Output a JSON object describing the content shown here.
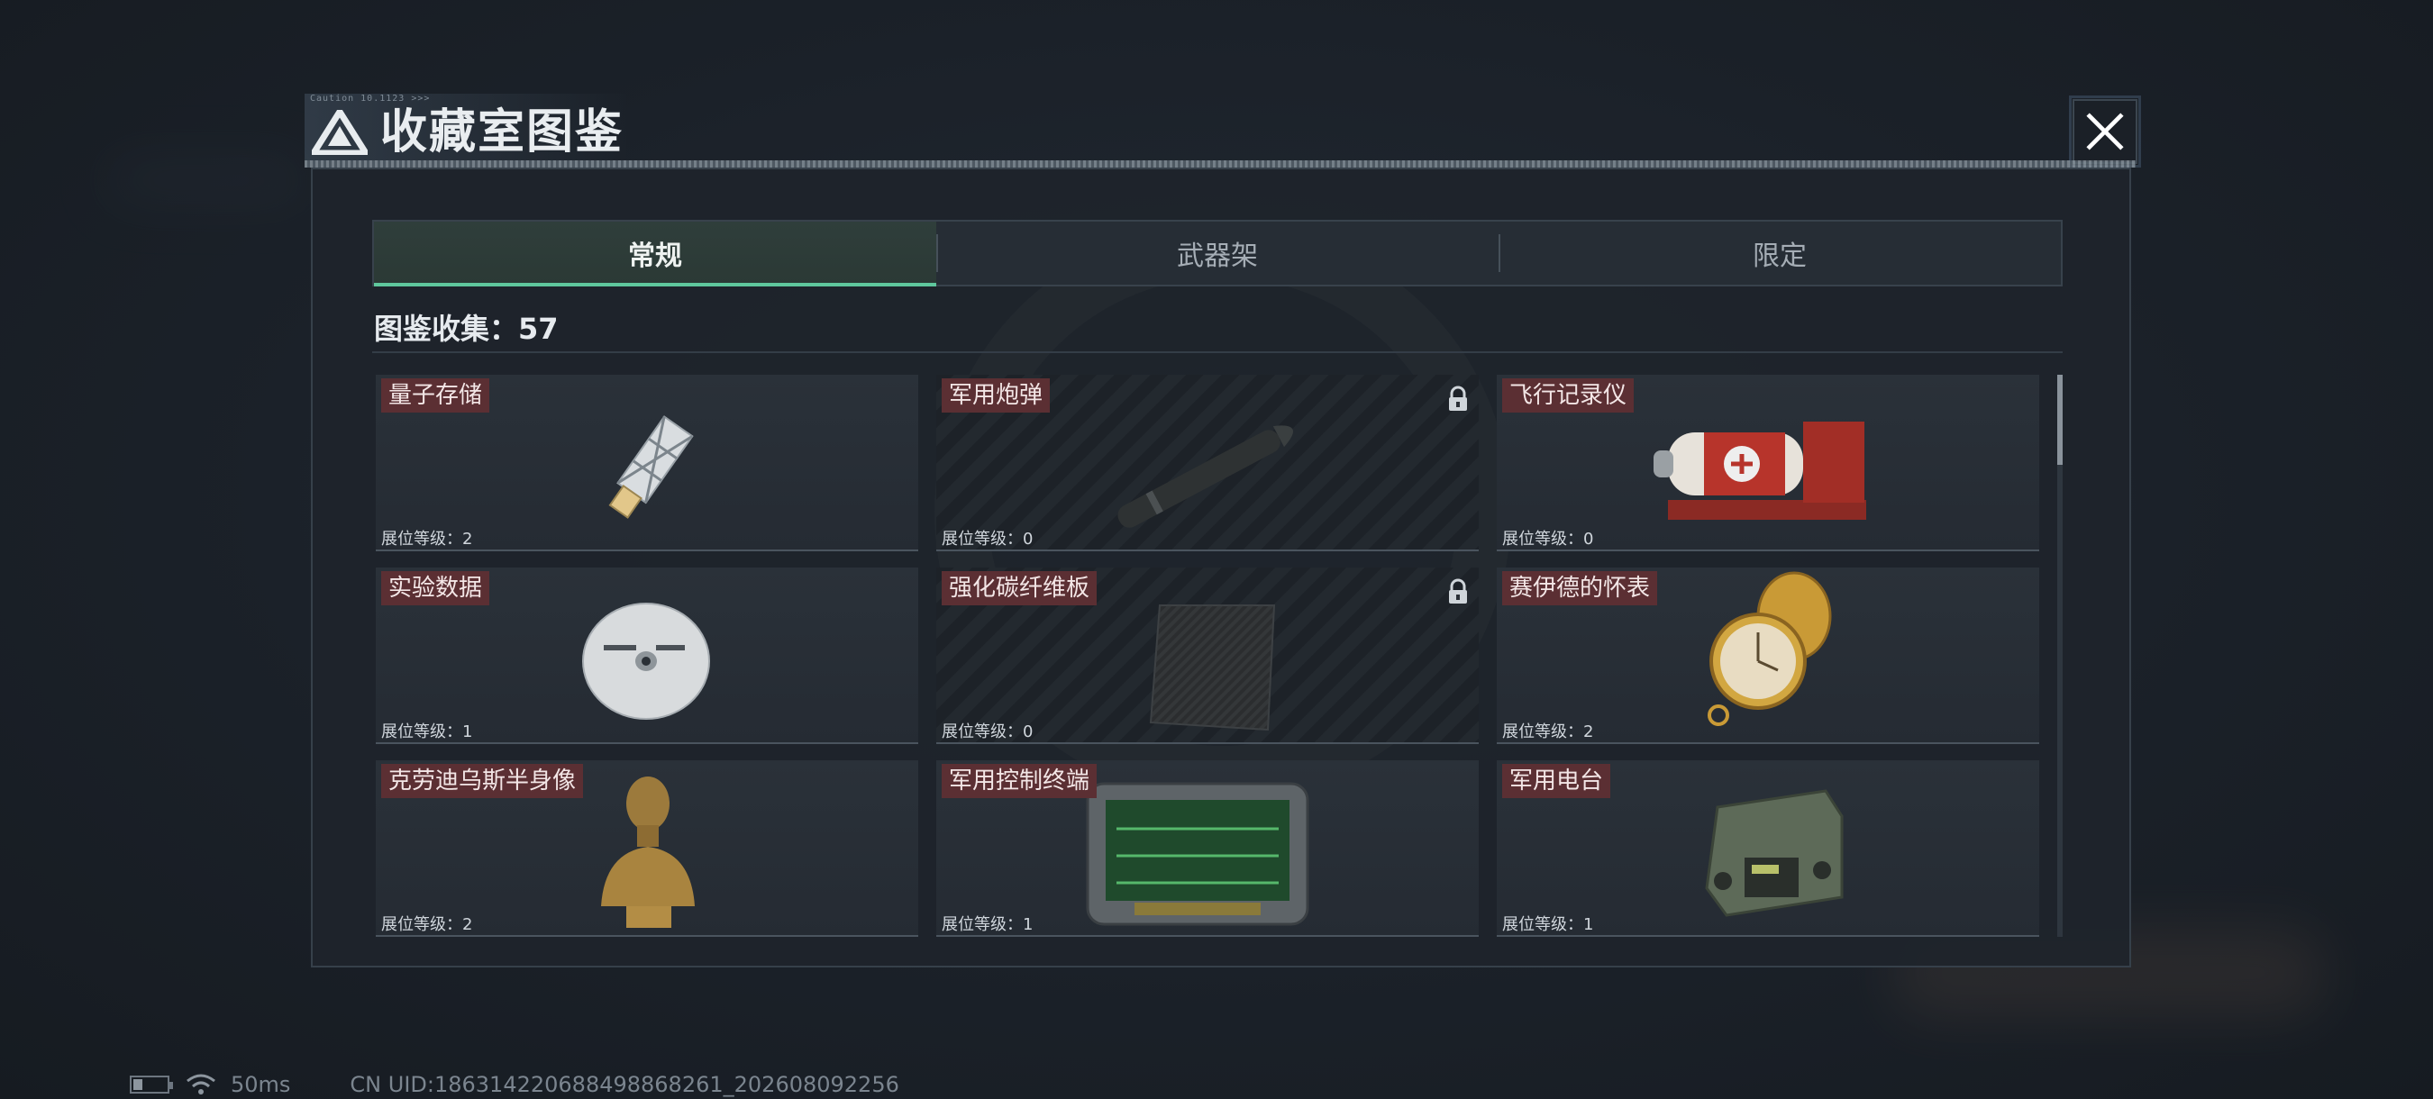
{
  "header": {
    "title": "收藏室图鉴",
    "micro_text": "Caution 10.1123 >>>"
  },
  "tabs": [
    {
      "label": "常规",
      "active": true
    },
    {
      "label": "武器架",
      "active": false
    },
    {
      "label": "限定",
      "active": false
    }
  ],
  "collection": {
    "label": "图鉴收集：57"
  },
  "items": [
    {
      "name": "量子存储",
      "level": "展位等级：2",
      "locked": false,
      "icon": "usb-drive-icon"
    },
    {
      "name": "军用炮弹",
      "level": "展位等级：0",
      "locked": true,
      "icon": "artillery-shell-icon"
    },
    {
      "name": "飞行记录仪",
      "level": "展位等级：0",
      "locked": false,
      "icon": "flight-recorder-icon"
    },
    {
      "name": "实验数据",
      "level": "展位等级：1",
      "locked": false,
      "icon": "disc-icon"
    },
    {
      "name": "强化碳纤维板",
      "level": "展位等级：0",
      "locked": true,
      "icon": "carbon-plate-icon"
    },
    {
      "name": "赛伊德的怀表",
      "level": "展位等级：2",
      "locked": false,
      "icon": "pocket-watch-icon"
    },
    {
      "name": "克劳迪乌斯半身像",
      "level": "展位等级：2",
      "locked": false,
      "icon": "bust-icon"
    },
    {
      "name": "军用控制终端",
      "level": "展位等级：1",
      "locked": false,
      "icon": "control-terminal-icon"
    },
    {
      "name": "军用电台",
      "level": "展位等级：1",
      "locked": false,
      "icon": "military-radio-icon"
    }
  ],
  "status": {
    "ping": "50ms",
    "uid": "CN UID:18631422068849886826​1_202608092256"
  },
  "colors": {
    "accent": "#5fc79d",
    "name_tag": "#5b2f33",
    "panel": "#1e242b"
  }
}
